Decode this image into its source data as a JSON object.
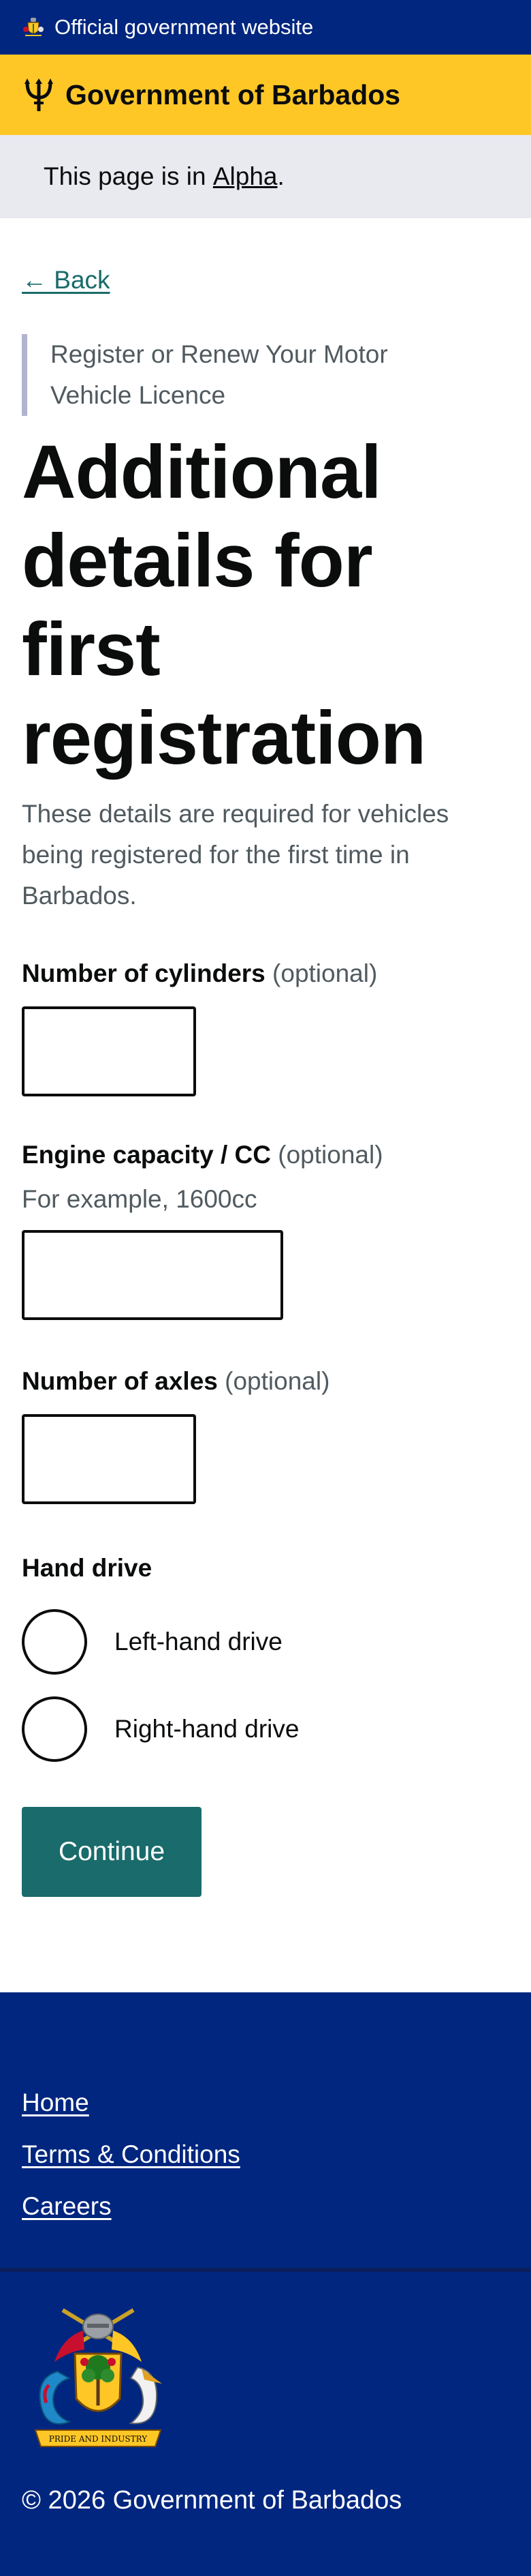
{
  "banner": {
    "official_text": "Official government website",
    "crest_icon": "coat-of-arms-icon"
  },
  "header": {
    "logo_icon": "trident-icon",
    "gov_name": "Government of Barbados"
  },
  "phase": {
    "prefix": "This page is in ",
    "link": "Alpha",
    "suffix": "."
  },
  "nav": {
    "back_label": "← Back"
  },
  "page": {
    "caption": "Register or Renew Your Motor Vehicle Licence",
    "title": "Additional details for first registration",
    "lede": "These details are required for vehicles being registered for the first time in Barbados."
  },
  "form": {
    "cylinders": {
      "label": "Number of cylinders",
      "optional": " (optional)",
      "value": ""
    },
    "engine": {
      "label": "Engine capacity / CC",
      "optional": " (optional)",
      "hint": "For example, 1600cc",
      "value": ""
    },
    "axles": {
      "label": "Number of axles",
      "optional": " (optional)",
      "value": ""
    },
    "hand_drive": {
      "legend": "Hand drive",
      "options": [
        {
          "label": "Left-hand drive",
          "checked": false
        },
        {
          "label": "Right-hand drive",
          "checked": false
        }
      ]
    },
    "continue_label": "Continue"
  },
  "footer": {
    "links": [
      "Home",
      "Terms & Conditions",
      "Careers"
    ],
    "copyright": "© 2026 Government of Barbados",
    "emblem_motto": "PRIDE AND INDUSTRY"
  },
  "colors": {
    "navy": "#00267f",
    "gold": "#ffc726",
    "teal": "#1a6b6b",
    "phase_bg": "#e8eaf0"
  }
}
